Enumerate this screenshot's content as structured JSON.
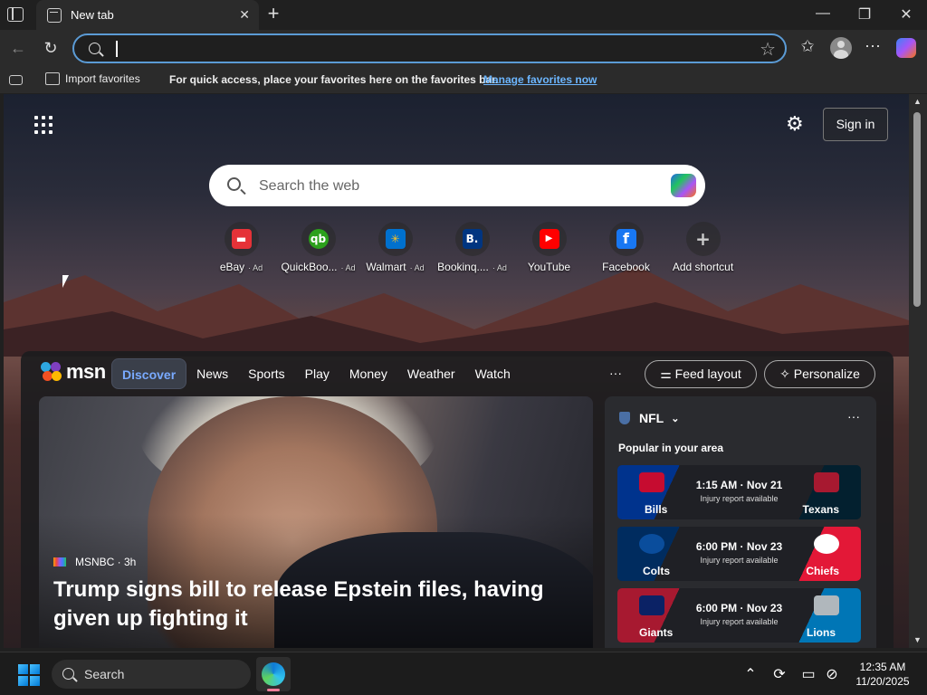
{
  "tab": {
    "title": "New tab",
    "close": "✕",
    "new": "+"
  },
  "window": {
    "minimize": "—",
    "maximize": "❐",
    "close": "✕"
  },
  "toolbar": {
    "back": "←",
    "reload": "↻",
    "more": "⋯"
  },
  "address": {
    "value": "",
    "star": "☆"
  },
  "favbar": {
    "import": "Import favorites",
    "hint": "For quick access, place your favorites here on the favorites bar.",
    "manage": "Manage favorites now"
  },
  "ntp": {
    "signin": "Sign in",
    "gear": "⚙",
    "search_placeholder": "Search the web",
    "shortcuts": [
      {
        "label": "eBay",
        "ad": "· Ad",
        "glyph": "▬",
        "color": "#e53238"
      },
      {
        "label": "QuickBoo...",
        "ad": "· Ad",
        "glyph": "qb",
        "color": "#2ca01c"
      },
      {
        "label": "Walmart",
        "ad": "· Ad",
        "glyph": "✳",
        "color": "#0071ce"
      },
      {
        "label": "Bookinq....",
        "ad": "· Ad",
        "glyph": "B.",
        "color": "#003580"
      },
      {
        "label": "YouTube",
        "ad": "",
        "glyph": "▶",
        "color": "#ff0000"
      },
      {
        "label": "Facebook",
        "ad": "",
        "glyph": "f",
        "color": "#1877f2"
      },
      {
        "label": "Add shortcut",
        "ad": "",
        "glyph": "+",
        "color": "transparent"
      }
    ]
  },
  "msn": {
    "logo": "msn",
    "nav": [
      "Discover",
      "News",
      "Sports",
      "Play",
      "Money",
      "Weather",
      "Watch"
    ],
    "more": "···",
    "feed_layout": "Feed layout",
    "personalize": "Personalize",
    "hero": {
      "source": "MSNBC · 3h",
      "headline": "Trump signs bill to release Epstein files, having given up fighting it"
    },
    "nfl": {
      "title": "NFL",
      "subtitle": "Popular in your area",
      "more": "···",
      "games": [
        {
          "away": "Bills",
          "home": "Texans",
          "time": "1:15 AM · Nov 21",
          "note": "Injury report available",
          "away_color": "#00338d",
          "home_color": "#03202f"
        },
        {
          "away": "Colts",
          "home": "Chiefs",
          "time": "6:00 PM · Nov 23",
          "note": "Injury report available",
          "away_color": "#002c5f",
          "home_color": "#e31837"
        },
        {
          "away": "Giants",
          "home": "Lions",
          "time": "6:00 PM · Nov 23",
          "note": "Injury report available",
          "away_color": "#a71930",
          "home_color": "#0076b6"
        }
      ]
    }
  },
  "taskbar": {
    "search": "Search",
    "time": "12:35 AM",
    "date": "11/20/2025"
  }
}
